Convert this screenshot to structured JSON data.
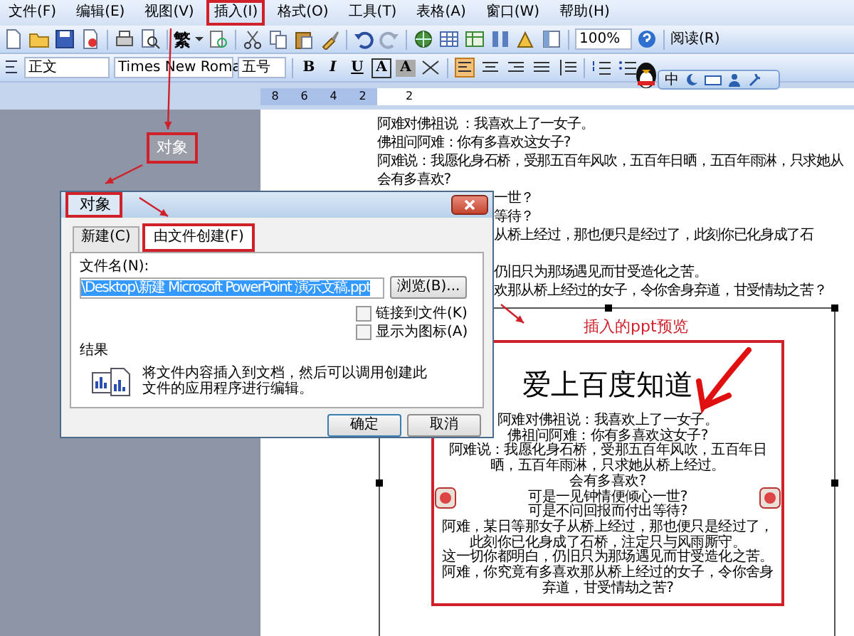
{
  "menu_bar": [
    {
      "label": "文件(F)",
      "annotated": false
    },
    {
      "label": "编辑(E)",
      "annotated": false
    },
    {
      "label": "视图(V)",
      "annotated": false
    },
    {
      "label": "插入(I)",
      "annotated": true
    },
    {
      "label": "格式(O)",
      "annotated": false
    },
    {
      "label": "工具(T)",
      "annotated": false
    },
    {
      "label": "表格(A)",
      "annotated": false
    },
    {
      "label": "窗口(W)",
      "annotated": false
    },
    {
      "label": "帮助(H)",
      "annotated": false
    }
  ],
  "standard_toolbar": {
    "script_glyph": "繁",
    "zoom": "100%",
    "read_button": "阅读(R)"
  },
  "format_toolbar": {
    "style": "正文",
    "font": "Times New Roma",
    "size": "五号",
    "buttons": [
      "B",
      "I",
      "U",
      "A",
      "A"
    ]
  },
  "language_bar": {
    "label": "中"
  },
  "ruler": {
    "ticks": [
      "8",
      "6",
      "4",
      "2"
    ],
    "right_ticks": [
      "2"
    ]
  },
  "document": {
    "lines": [
      "阿难对佛祖说 ：我喜欢上了一女子。",
      "佛祖问阿难：你有多喜欢这女子?",
      "阿难说：我愿化身石桥，受那五百年风吹，五百年日晒，五百年雨淋，只求她从",
      "会有多喜欢?"
    ],
    "partly_covered_lines": [
      {
        "text": "一世？",
        "spaced": false
      },
      {
        "text": "等待？",
        "spaced": false
      },
      {
        "text": "从桥上经过，那也便只是经过了，此刻你已化身成了石",
        "spaced": false
      },
      {
        "text": "仍旧只为那场遇见而甘受造化之苦。",
        "spaced": true
      },
      {
        "text": "欢那从桥上经过的女子，令你舍身弃道，甘受情劫之苦？",
        "spaced": false
      }
    ]
  },
  "embedded_preview": {
    "title": "爱上百度知道",
    "lines": [
      "阿难对佛祖说：我喜欢上了一女子。",
      "佛祖问阿难：你有多喜欢这女子?",
      "阿难说：我愿化身石桥，受那五百年风吹，五百年日",
      "晒，五百年雨淋，只求她从桥上经过。",
      "会有多喜欢?",
      "可是一见钟情便倾心一世?",
      "可是不问回报而付出等待?",
      "阿难，某日等那女子从桥上经过，那也便只是经过了，",
      "此刻你已化身成了石桥，注定只与风雨厮守。",
      "这一切你都明白，仍旧只为那场遇见而甘受造化之苦。",
      "阿难，你究竟有多喜欢那从桥上经过的女子，令你舍身",
      "弃道，甘受情劫之苦?"
    ]
  },
  "dialog": {
    "title": "对象",
    "title_annotated": true,
    "tabs": [
      {
        "label": "新建(C)",
        "selected": false,
        "annotated": false
      },
      {
        "label": "由文件创建(F)",
        "selected": true,
        "annotated": true
      }
    ],
    "file_label": "文件名(N):",
    "file_value": "\\Desktop\\新建 Microsoft PowerPoint 演示文稿.ppt",
    "browse_button": "浏览(B)...",
    "checkboxes": [
      {
        "label": "链接到文件(K)",
        "checked": false
      },
      {
        "label": "显示为图标(A)",
        "checked": false
      }
    ],
    "result_label": "结果",
    "result_text": "将文件内容插入到文档，然后可以调用创建此文件的应用程序进行编辑。",
    "buttons": [
      {
        "label": "确定",
        "default": true
      },
      {
        "label": "取消",
        "default": false
      }
    ]
  },
  "annotations": {
    "callout": "对象",
    "preview_label": "插入的ppt预览"
  }
}
